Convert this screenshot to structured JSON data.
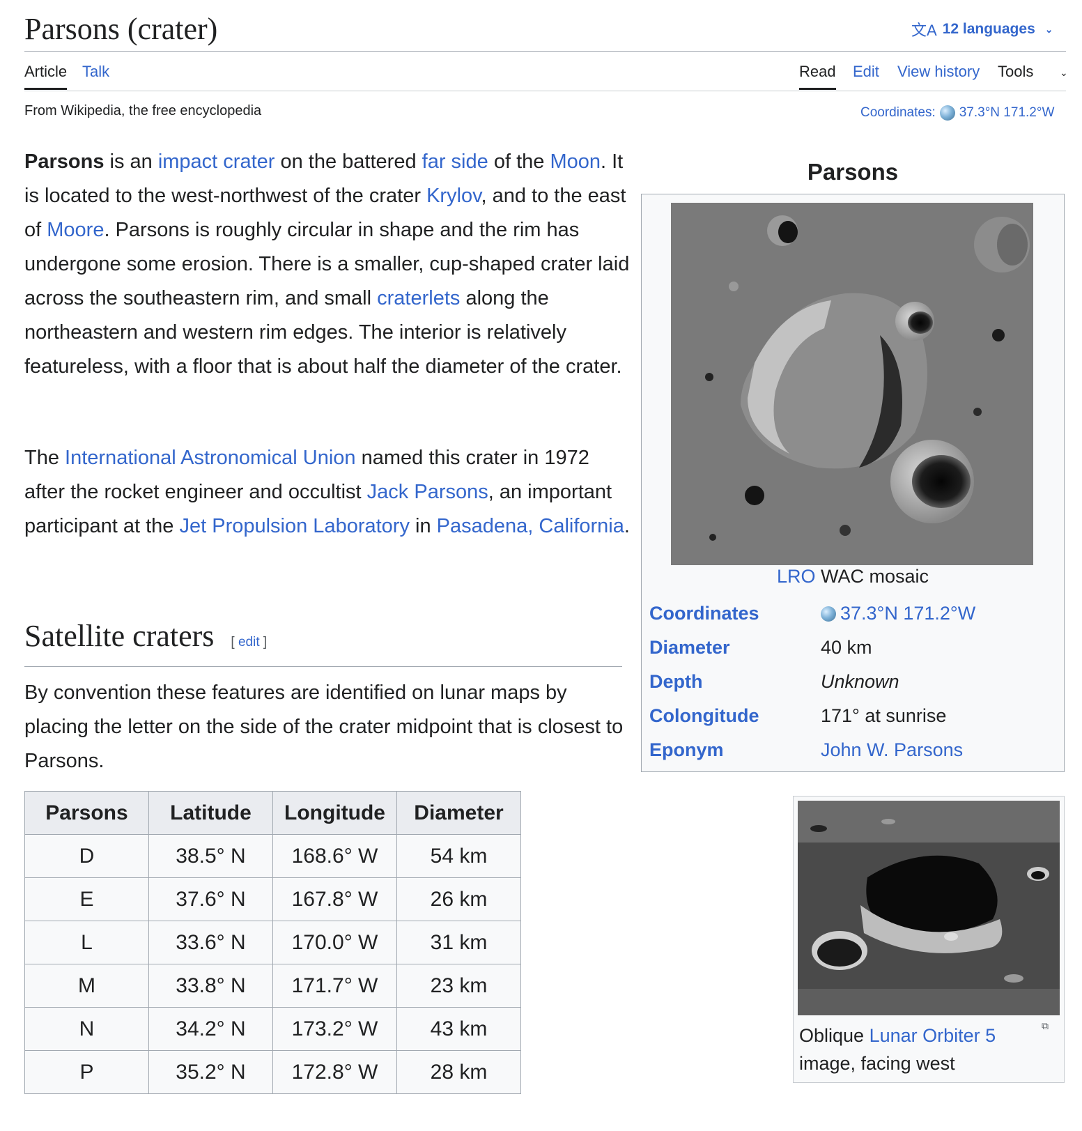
{
  "header": {
    "title": "Parsons (crater)",
    "languages_label": "12 languages",
    "left_tabs": [
      {
        "label": "Article"
      },
      {
        "label": "Talk"
      }
    ],
    "right_tabs": [
      {
        "label": "Read"
      },
      {
        "label": "Edit"
      },
      {
        "label": "View history"
      },
      {
        "label": "Tools"
      }
    ],
    "tagline": "From Wikipedia, the free encyclopedia",
    "coordinates_label": "Coordinates:",
    "coordinates_value": "37.3°N 171.2°W"
  },
  "article": {
    "p1": [
      {
        "t": "Parsons",
        "b": true
      },
      {
        "t": " is an "
      },
      {
        "t": "impact crater",
        "link": true
      },
      {
        "t": " on the battered "
      },
      {
        "t": "far side",
        "link": true
      },
      {
        "t": " of the "
      },
      {
        "t": "Moon",
        "link": true
      },
      {
        "t": ". It is located to the west-northwest of the crater "
      },
      {
        "t": "Krylov",
        "link": true
      },
      {
        "t": ", and to the east of "
      },
      {
        "t": "Moore",
        "link": true
      },
      {
        "t": ". Parsons is roughly circular in shape and the rim has undergone some erosion. There is a smaller, cup-shaped crater laid across the southeastern rim, and small "
      },
      {
        "t": "craterlets",
        "link": true
      },
      {
        "t": " along the northeastern and western rim edges. The interior is relatively featureless, with a floor that is about half the diameter of the crater."
      }
    ],
    "p2": [
      {
        "t": "The "
      },
      {
        "t": "International Astronomical Union",
        "link": true
      },
      {
        "t": " named this crater in 1972 after the rocket engineer and occultist "
      },
      {
        "t": "Jack Parsons",
        "link": true
      },
      {
        "t": ", an important participant at the "
      },
      {
        "t": "Jet Propulsion Laboratory",
        "link": true
      },
      {
        "t": " in "
      },
      {
        "t": "Pasadena, California",
        "link": true
      },
      {
        "t": "."
      }
    ],
    "section_title": "Satellite craters",
    "section_edit": "[ edit ]",
    "p3": "By convention these features are identified on lunar maps by placing the letter on the side of the crater midpoint that is closest to Parsons."
  },
  "table": {
    "headers": [
      "Parsons",
      "Latitude",
      "Longitude",
      "Diameter"
    ],
    "rows": [
      [
        "D",
        "38.5° N",
        "168.6° W",
        "54 km"
      ],
      [
        "E",
        "37.6° N",
        "167.8° W",
        "26 km"
      ],
      [
        "L",
        "33.6° N",
        "170.0° W",
        "31 km"
      ],
      [
        "M",
        "33.8° N",
        "171.7° W",
        "23 km"
      ],
      [
        "N",
        "34.2° N",
        "173.2° W",
        "43 km"
      ],
      [
        "P",
        "35.2° N",
        "172.8° W",
        "28 km"
      ]
    ]
  },
  "infobox": {
    "title": "Parsons",
    "caption_link": "LRO",
    "caption_text": " WAC mosaic",
    "rows": [
      {
        "label": "Coordinates",
        "value": "37.3°N 171.2°W"
      },
      {
        "label": "Diameter",
        "value": "40 km"
      },
      {
        "label": "Depth",
        "value": "Unknown"
      },
      {
        "label": "Colongitude",
        "value": "171° at sunrise"
      },
      {
        "label": "Eponym",
        "value": "John W. Parsons"
      }
    ]
  },
  "thumb": {
    "caption_prefix": "Oblique ",
    "caption_link": "Lunar Orbiter 5",
    "caption_suffix": " image, facing west"
  },
  "colors": {
    "link": "#3366cc",
    "text": "#202122",
    "border": "#a2a9b1",
    "infobox_bg": "#f8f9fa"
  }
}
